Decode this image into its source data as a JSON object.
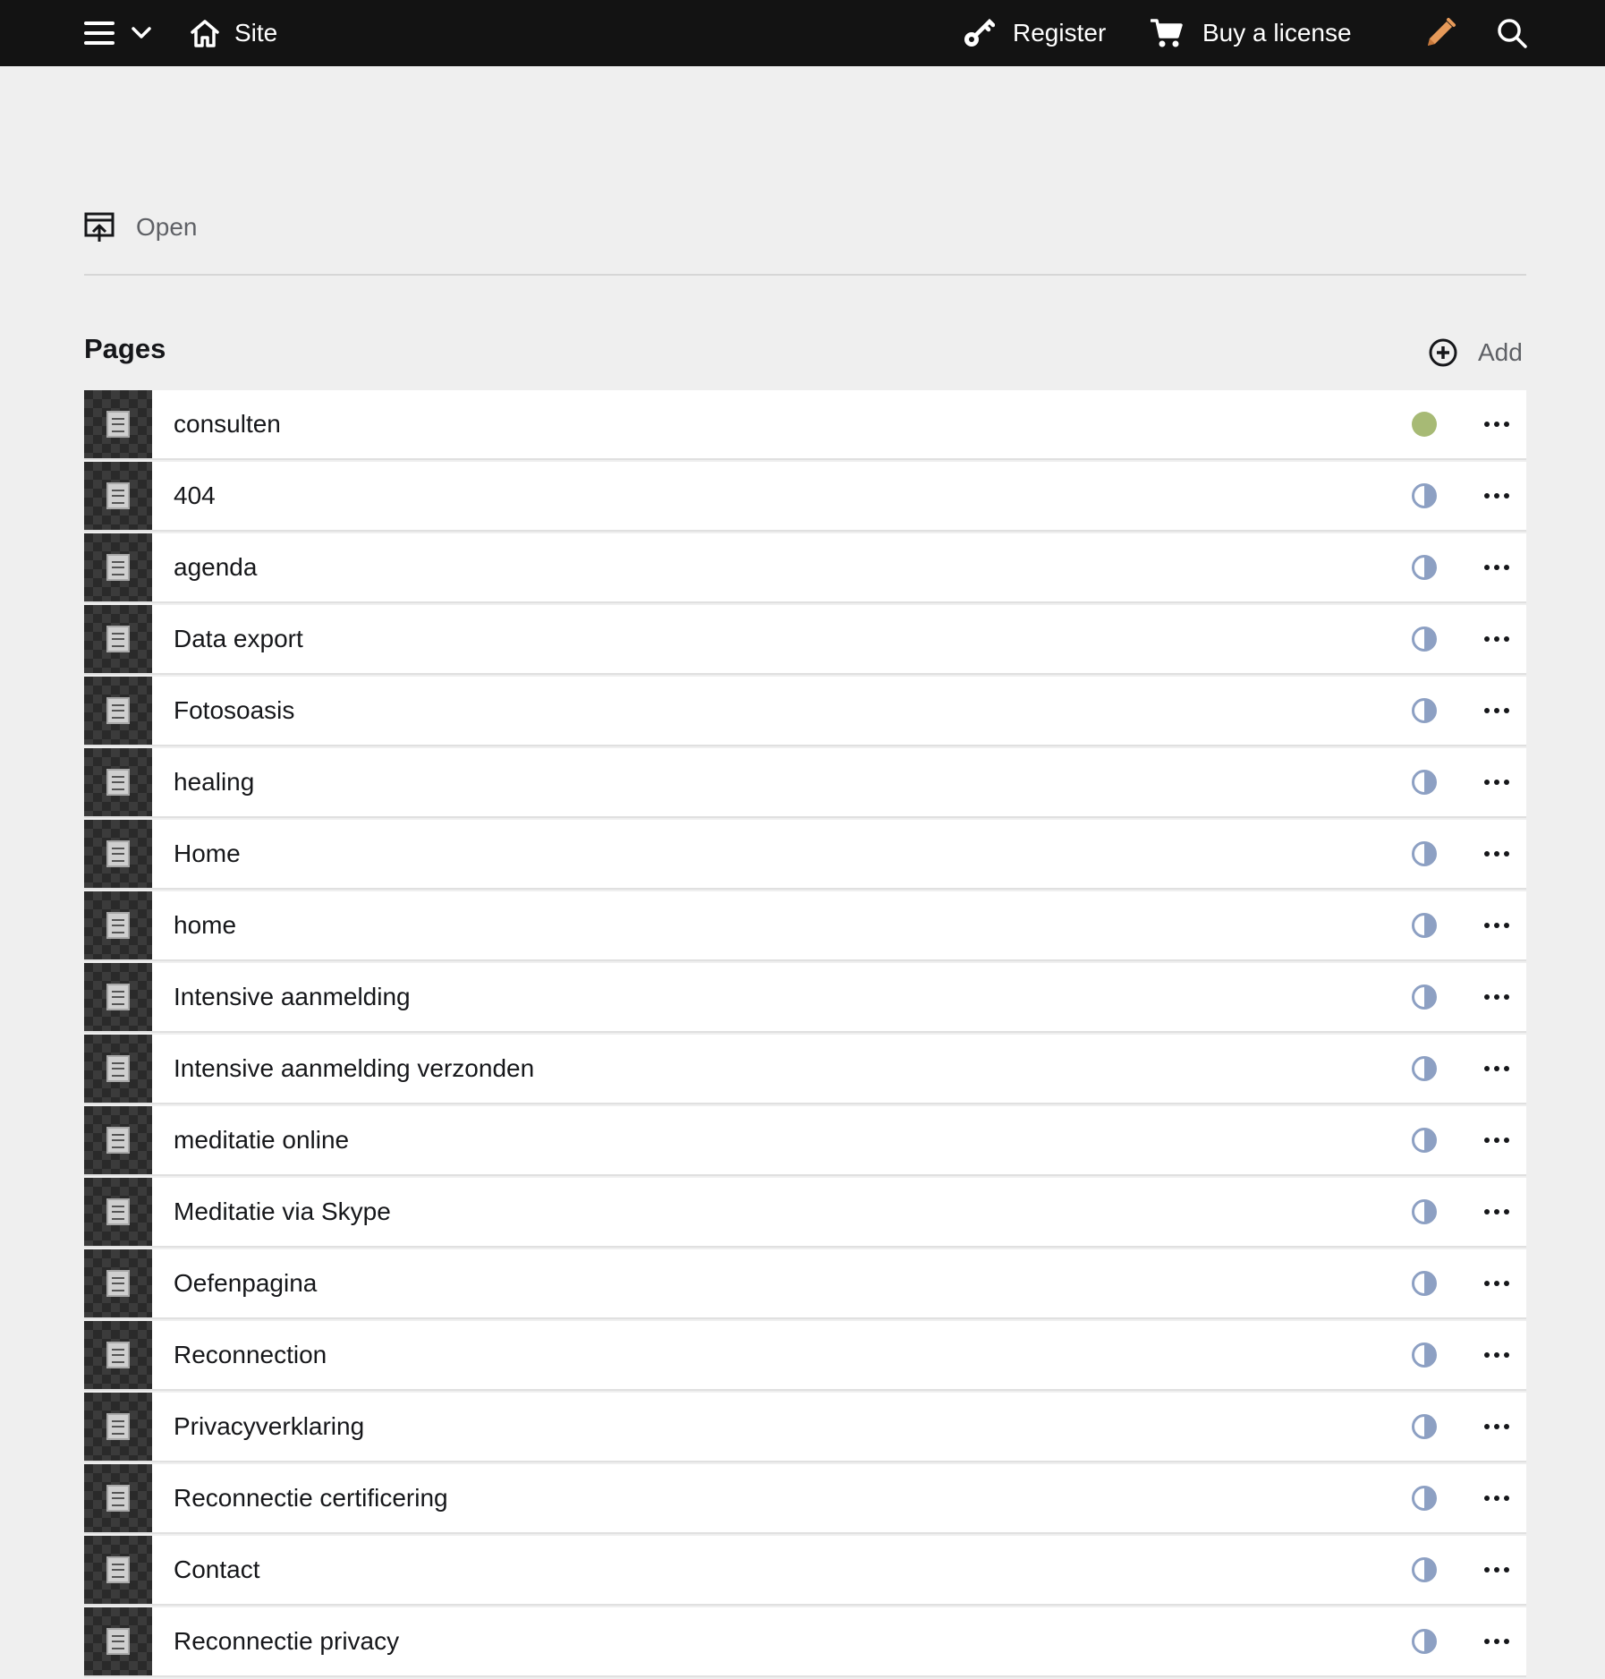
{
  "topbar": {
    "site_label": "Site",
    "register_label": "Register",
    "license_label": "Buy a license"
  },
  "open": {
    "label": "Open"
  },
  "pages": {
    "title": "Pages",
    "add_label": "Add",
    "items": [
      {
        "title": "consulten",
        "status": "published"
      },
      {
        "title": "404",
        "status": "draft"
      },
      {
        "title": "agenda",
        "status": "draft"
      },
      {
        "title": "Data export",
        "status": "draft"
      },
      {
        "title": "Fotosoasis",
        "status": "draft"
      },
      {
        "title": "healing",
        "status": "draft"
      },
      {
        "title": "Home",
        "status": "draft"
      },
      {
        "title": "home",
        "status": "draft"
      },
      {
        "title": "Intensive aanmelding",
        "status": "draft"
      },
      {
        "title": "Intensive aanmelding verzonden",
        "status": "draft"
      },
      {
        "title": "meditatie online",
        "status": "draft"
      },
      {
        "title": "Meditatie via Skype",
        "status": "draft"
      },
      {
        "title": "Oefenpagina",
        "status": "draft"
      },
      {
        "title": "Reconnection",
        "status": "draft"
      },
      {
        "title": "Privacyverklaring",
        "status": "draft"
      },
      {
        "title": "Reconnectie certificering",
        "status": "draft"
      },
      {
        "title": "Contact",
        "status": "draft"
      },
      {
        "title": "Reconnectie privacy",
        "status": "draft"
      }
    ]
  },
  "colors": {
    "topbar": "#131313",
    "published": "#a7ba75",
    "draft": "#8da0c3",
    "edit_icon": "#e69a5a"
  }
}
